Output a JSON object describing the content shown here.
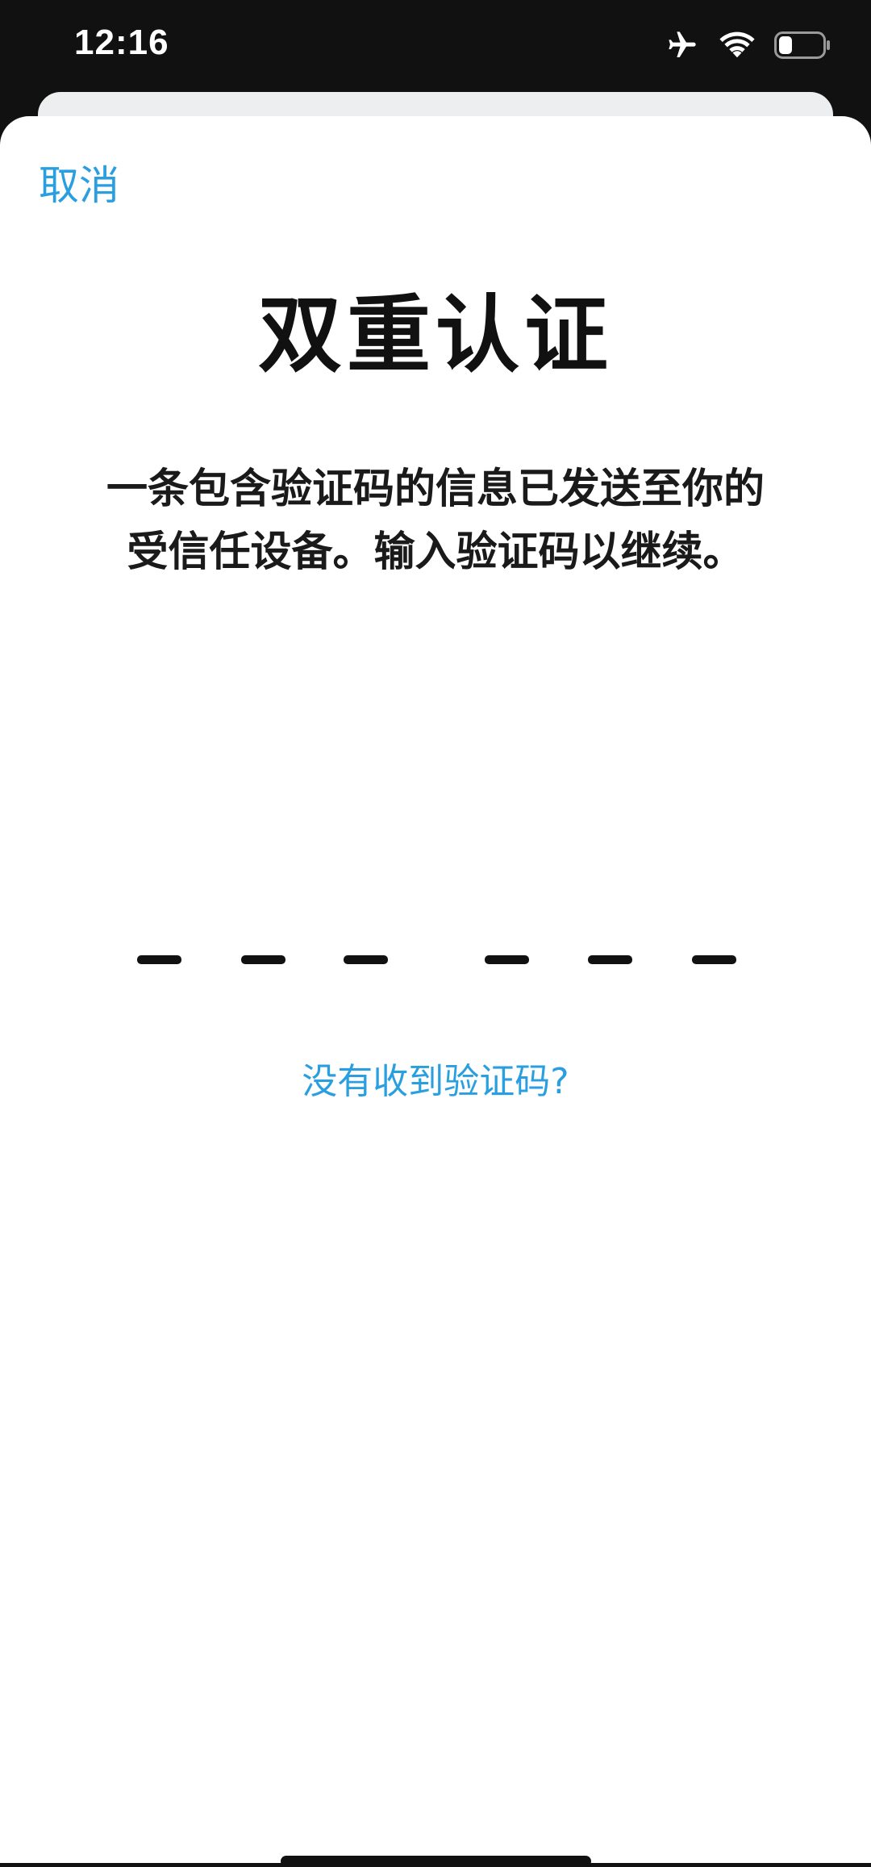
{
  "status_bar": {
    "time": "12:16",
    "icons": [
      "airplane-mode-icon",
      "wifi-icon",
      "battery-icon"
    ],
    "battery_level": 0.3
  },
  "sheet": {
    "cancel_label": "取消",
    "title": "双重认证",
    "description": "一条包含验证码的信息已发送至你的受信任设备。输入验证码以继续。",
    "code": {
      "length": 6,
      "value": ""
    },
    "resend_label": "没有收到验证码?"
  },
  "colors": {
    "accent": "#2a9fe0",
    "text": "#111111",
    "status_bar_bg": "#111111",
    "sheet_bg": "#ffffff"
  }
}
